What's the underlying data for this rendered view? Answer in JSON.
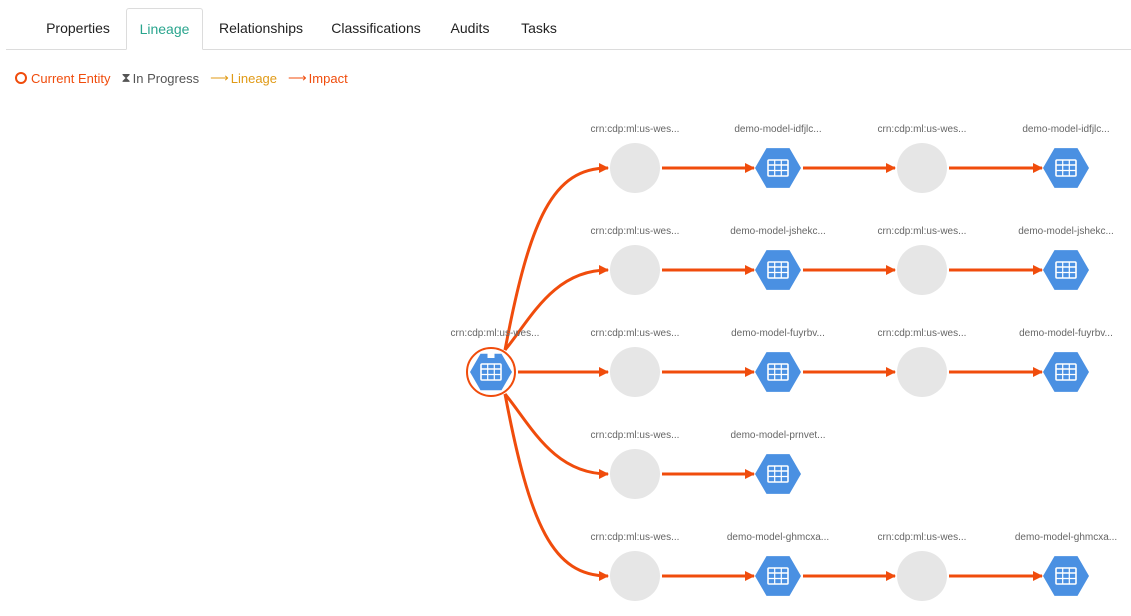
{
  "tabs": [
    {
      "label": "Properties",
      "active": false
    },
    {
      "label": "Lineage",
      "active": true
    },
    {
      "label": "Relationships",
      "active": false
    },
    {
      "label": "Classifications",
      "active": false
    },
    {
      "label": "Audits",
      "active": false
    },
    {
      "label": "Tasks",
      "active": false
    }
  ],
  "legend": {
    "current_entity": "Current Entity",
    "in_progress": "In Progress",
    "lineage": "Lineage",
    "impact": "Impact"
  },
  "colors": {
    "impact": "#f04c0c",
    "lineage": "#e09a16",
    "accent": "#2aa58e",
    "entity": "#4a90e2",
    "process": "#e6e6e6"
  },
  "graph": {
    "current_entity": {
      "label": "crn:cdp:ml:us-wes...",
      "icon": "table-hexagon-icon"
    },
    "rows": [
      {
        "process1": "crn:cdp:ml:us-wes...",
        "model1": "demo-model-idfjlc...",
        "process2": "crn:cdp:ml:us-wes...",
        "model2": "demo-model-idfjlc..."
      },
      {
        "process1": "crn:cdp:ml:us-wes...",
        "model1": "demo-model-jshekc...",
        "process2": "crn:cdp:ml:us-wes...",
        "model2": "demo-model-jshekc..."
      },
      {
        "process1": "crn:cdp:ml:us-wes...",
        "model1": "demo-model-fuyrbv...",
        "process2": "crn:cdp:ml:us-wes...",
        "model2": "demo-model-fuyrbv..."
      },
      {
        "process1": "crn:cdp:ml:us-wes...",
        "model1": "demo-model-prnvet..."
      },
      {
        "process1": "crn:cdp:ml:us-wes...",
        "model1": "demo-model-ghmcxa...",
        "process2": "crn:cdp:ml:us-wes...",
        "model2": "demo-model-ghmcxa..."
      }
    ]
  }
}
